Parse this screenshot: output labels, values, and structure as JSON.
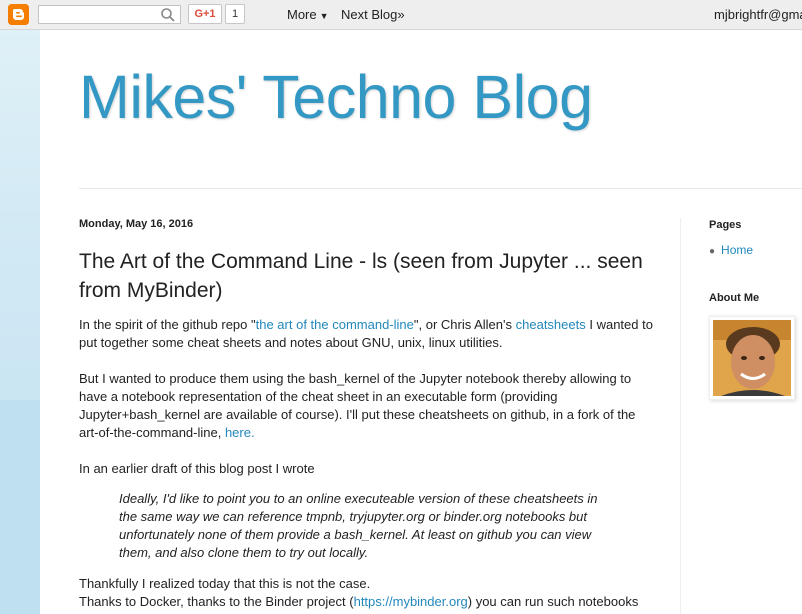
{
  "navbar": {
    "search_value": "",
    "gplus_label": "G+1",
    "gplus_count": "1",
    "more_label": "More",
    "next_blog_label": "Next Blog»",
    "user_label": "mjbrightfr@gma"
  },
  "blog": {
    "title": "Mikes' Techno Blog"
  },
  "post": {
    "date": "Monday, May 16, 2016",
    "title": "The Art of the Command Line - ls (seen from Jupyter ... seen from MyBinder)",
    "p1": {
      "pre": "In the spirit of the github repo \"",
      "link1": "the art of the command-line",
      "mid": "\", or Chris Allen's ",
      "link2": "cheatsheets",
      "post": " I wanted to put together some cheat sheets and notes about GNU, unix, linux utilities."
    },
    "p2": {
      "text": "But I wanted to produce them using the bash_kernel of the Jupyter notebook thereby allowing to have a notebook representation of the cheat sheet in an executable form (providing Jupyter+bash_kernel are available of course).  I'll put these cheatsheets on github, in a fork of the art-of-the-command-line, ",
      "link": "here."
    },
    "p3": "In an earlier draft of this blog post I wrote",
    "quote": "Ideally, I'd like to point you to an online executeable version of these cheatsheets in the same way we can reference tmpnb, tryjupyter.org or binder.org notebooks but unfortunately none of them provide a bash_kernel.  At least on github you can view them, and also clone them to try out locally.",
    "p4": {
      "line1": "Thankfully I realized today that this is not the case.",
      "pre": "Thanks to Docker, thanks to the Binder project (",
      "link": "https://mybinder.org",
      "post": ") you can run such notebooks"
    }
  },
  "sidebar": {
    "pages_title": "Pages",
    "pages": [
      {
        "label": "Home"
      }
    ],
    "about_title": "About Me"
  },
  "colors": {
    "title_blue": "#3398c4",
    "link_blue": "#2288bb",
    "blogger_orange": "#f57d00",
    "gplus_red": "#dd4b39"
  }
}
